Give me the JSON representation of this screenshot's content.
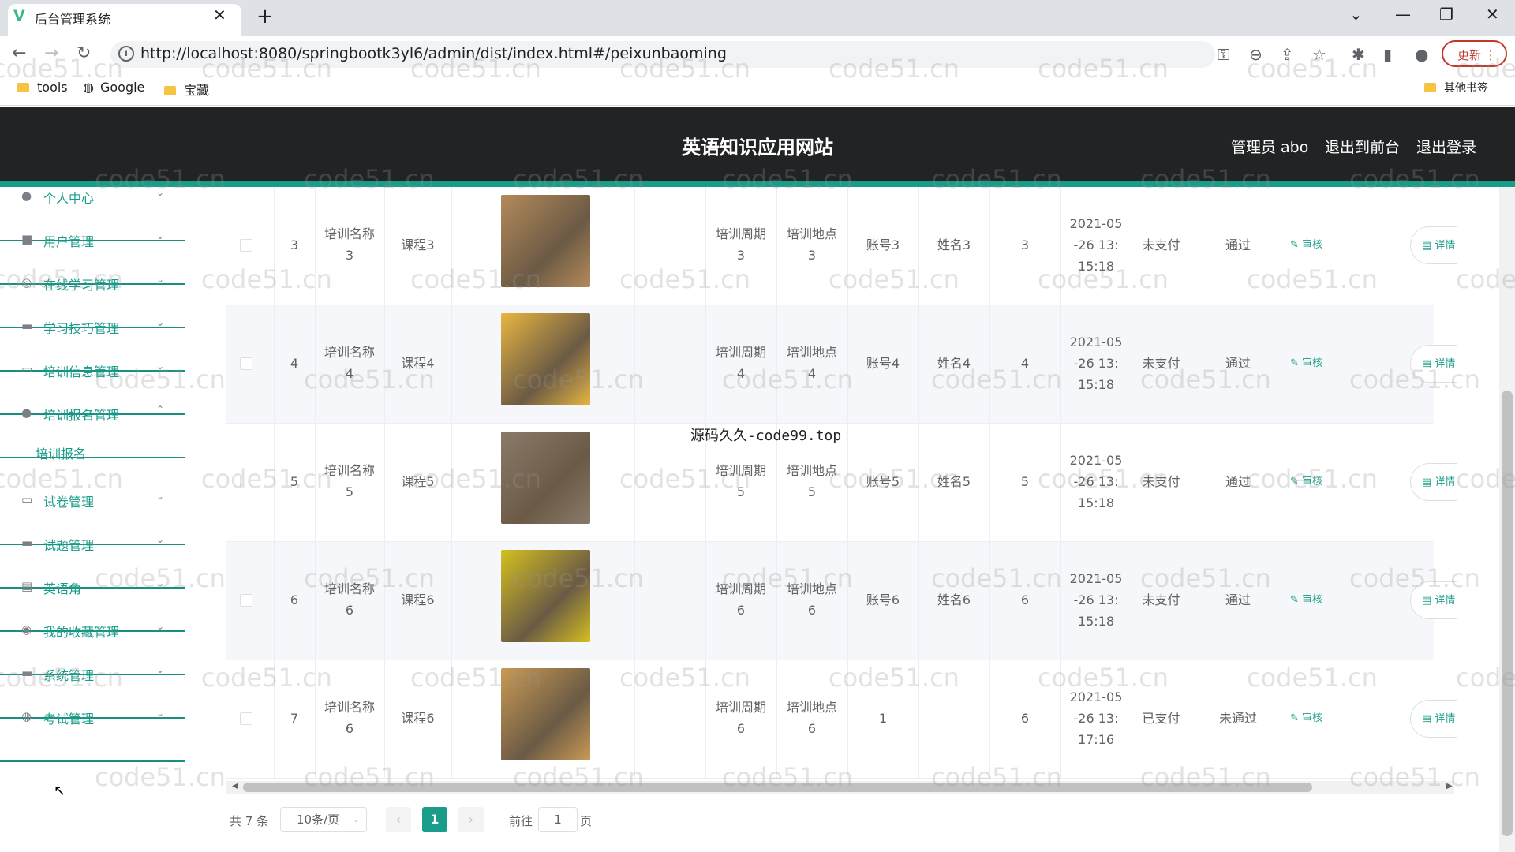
{
  "browser": {
    "tab_title": "后台管理系统",
    "tab_close": "✕",
    "new_tab": "+",
    "url": "http://localhost:8080/springbootk3yl6/admin/dist/index.html#/peixunbaoming",
    "update_label": "更新",
    "bookmarks": [
      "tools",
      "Google",
      "宝藏"
    ],
    "other_bookmarks": "其他书签"
  },
  "header": {
    "title": "英语知识应用网站",
    "admin_label": "管理员 abo",
    "to_front": "退出到前台",
    "logout": "退出登录"
  },
  "sidebar": {
    "items": [
      {
        "label": "个人中心",
        "icon": "user-icon"
      },
      {
        "label": "用户管理",
        "icon": "users-icon"
      },
      {
        "label": "在线学习管理",
        "icon": "learn-icon"
      },
      {
        "label": "学习技巧管理",
        "icon": "tips-icon"
      },
      {
        "label": "培训信息管理",
        "icon": "training-icon"
      },
      {
        "label": "培训报名管理",
        "icon": "signup-icon"
      },
      {
        "label": "试卷管理",
        "icon": "paper-icon"
      },
      {
        "label": "试题管理",
        "icon": "question-icon"
      },
      {
        "label": "英语角",
        "icon": "corner-icon"
      },
      {
        "label": "我的收藏管理",
        "icon": "favorite-icon"
      },
      {
        "label": "系统管理",
        "icon": "system-icon"
      },
      {
        "label": "考试管理",
        "icon": "exam-icon"
      }
    ],
    "subitem": "培训报名"
  },
  "table": {
    "rows": [
      {
        "idx": "3",
        "name": "培训名称3",
        "course": "课程3",
        "period": "培训周期3",
        "place": "培训地点3",
        "account": "账号3",
        "person": "姓名3",
        "num": "3",
        "time": "2021-05-26 13:15:18",
        "pay": "未支付",
        "audit": "通过",
        "thumb_color": "#b48a5a"
      },
      {
        "idx": "4",
        "name": "培训名称4",
        "course": "课程4",
        "period": "培训周期4",
        "place": "培训地点4",
        "account": "账号4",
        "person": "姓名4",
        "num": "4",
        "time": "2021-05-26 13:15:18",
        "pay": "未支付",
        "audit": "通过",
        "thumb_color": "#e8b640"
      },
      {
        "idx": "5",
        "name": "培训名称5",
        "course": "课程5",
        "period": "培训周期5",
        "place": "培训地点5",
        "account": "账号5",
        "person": "姓名5",
        "num": "5",
        "time": "2021-05-26 13:15:18",
        "pay": "未支付",
        "audit": "通过",
        "thumb_color": "#8a7a6a"
      },
      {
        "idx": "6",
        "name": "培训名称6",
        "course": "课程6",
        "period": "培训周期6",
        "place": "培训地点6",
        "account": "账号6",
        "person": "姓名6",
        "num": "6",
        "time": "2021-05-26 13:15:18",
        "pay": "未支付",
        "audit": "通过",
        "thumb_color": "#d4c020"
      },
      {
        "idx": "7",
        "name": "培训名称6",
        "course": "课程6",
        "period": "培训周期6",
        "place": "培训地点6",
        "account": "1",
        "person": "",
        "num": "6",
        "time": "2021-05-26 13:17:16",
        "pay": "已支付",
        "audit": "未通过",
        "thumb_color": "#c99a55"
      }
    ],
    "audit_btn": "✎ 审核",
    "detail_btn": "▤ 详情"
  },
  "pagination": {
    "total": "共 7 条",
    "page_size": "10条/页",
    "current": "1",
    "goto_prefix": "前往",
    "goto_value": "1",
    "goto_suffix": "页"
  },
  "overlay_text": "源码久久-code99.top",
  "watermark": "code51.cn"
}
